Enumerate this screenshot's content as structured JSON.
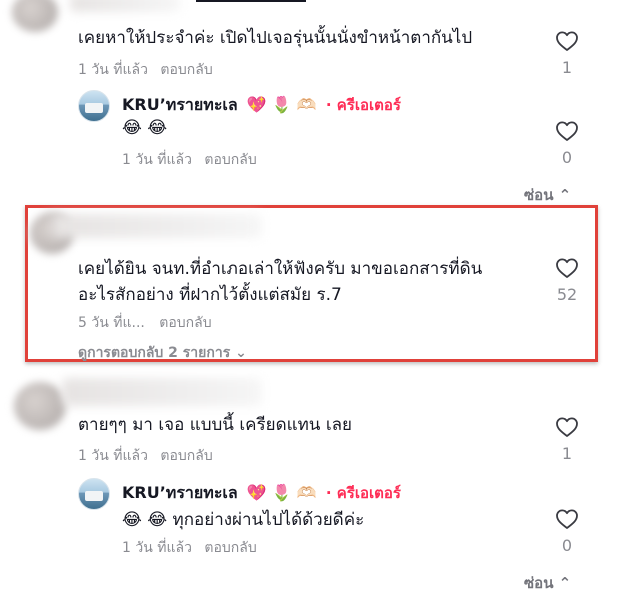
{
  "comments": [
    {
      "text": "เคยหาให้ประจำค่ะ เปิดไปเจอรุ่นนั้นนั่งขำหน้าตากันไป",
      "time": "1 วัน ที่แล้ว",
      "reply": "ตอบกลับ",
      "likes": "1",
      "creator_reply": {
        "name": "KRU’ทรายทะเล",
        "badges": "💖 🌷 🫶🏻",
        "badge_label": "· ครีเอเตอร์",
        "text": "😂 😂",
        "time": "1 วัน ที่แล้ว",
        "reply": "ตอบกลับ",
        "likes": "0"
      },
      "toggle": "ซ่อน ⌃"
    },
    {
      "line1": "เคยได้ยิน จนท.ที่อำเภอเล่าให้ฟังครับ มาขอเอกสารที่ดิน",
      "line2": "อะไรสักอย่าง ที่ฝากไว้ตั้งแต่สมัย ร.7",
      "time": "5 วัน ที่แ...",
      "reply": "ตอบกลับ",
      "likes": "52",
      "view_replies": "ดูการตอบกลับ 2 รายการ ⌄"
    },
    {
      "text": "ตายๆๆ มา เจอ แบบนี้ เครียดแทน เลย",
      "time": "1 วัน ที่แล้ว",
      "reply": "ตอบกลับ",
      "likes": "1",
      "creator_reply": {
        "name": "KRU’ทรายทะเล",
        "badges": "💖 🌷 🫶🏻",
        "badge_label": "· ครีเอเตอร์",
        "text": "😂 😂  ทุกอย่างผ่านไปได้ด้วยดีค่ะ",
        "time": "1 วัน ที่แล้ว",
        "reply": "ตอบกลับ",
        "likes": "0"
      },
      "toggle": "ซ่อน ⌃"
    }
  ],
  "colors": {
    "text": "#161823",
    "muted": "#8a8b91",
    "creator": "#fe2c55",
    "highlight": "#e0413a"
  },
  "icons": {
    "like": "heart-outline-icon",
    "avatar_blurred": "avatar-icon"
  }
}
